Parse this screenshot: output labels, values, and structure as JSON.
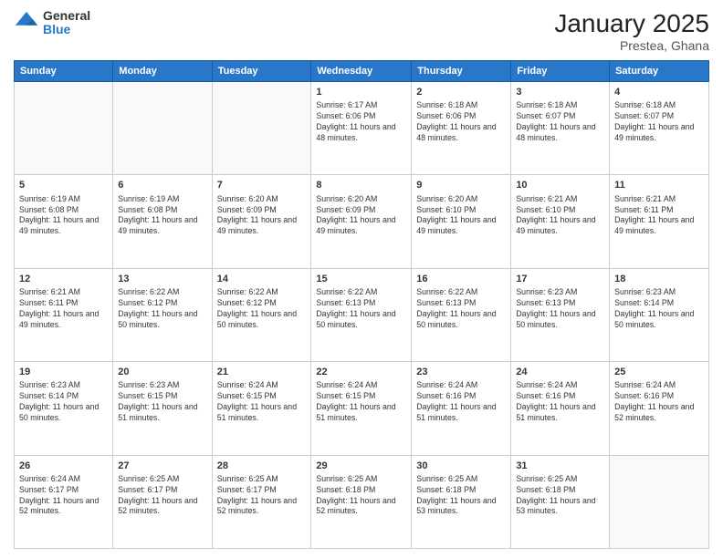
{
  "header": {
    "logo": {
      "general": "General",
      "blue": "Blue"
    },
    "title": "January 2025",
    "subtitle": "Prestea, Ghana"
  },
  "calendar": {
    "days_of_week": [
      "Sunday",
      "Monday",
      "Tuesday",
      "Wednesday",
      "Thursday",
      "Friday",
      "Saturday"
    ],
    "weeks": [
      [
        {
          "day": "",
          "info": ""
        },
        {
          "day": "",
          "info": ""
        },
        {
          "day": "",
          "info": ""
        },
        {
          "day": "1",
          "info": "Sunrise: 6:17 AM\nSunset: 6:06 PM\nDaylight: 11 hours and 48 minutes."
        },
        {
          "day": "2",
          "info": "Sunrise: 6:18 AM\nSunset: 6:06 PM\nDaylight: 11 hours and 48 minutes."
        },
        {
          "day": "3",
          "info": "Sunrise: 6:18 AM\nSunset: 6:07 PM\nDaylight: 11 hours and 48 minutes."
        },
        {
          "day": "4",
          "info": "Sunrise: 6:18 AM\nSunset: 6:07 PM\nDaylight: 11 hours and 49 minutes."
        }
      ],
      [
        {
          "day": "5",
          "info": "Sunrise: 6:19 AM\nSunset: 6:08 PM\nDaylight: 11 hours and 49 minutes."
        },
        {
          "day": "6",
          "info": "Sunrise: 6:19 AM\nSunset: 6:08 PM\nDaylight: 11 hours and 49 minutes."
        },
        {
          "day": "7",
          "info": "Sunrise: 6:20 AM\nSunset: 6:09 PM\nDaylight: 11 hours and 49 minutes."
        },
        {
          "day": "8",
          "info": "Sunrise: 6:20 AM\nSunset: 6:09 PM\nDaylight: 11 hours and 49 minutes."
        },
        {
          "day": "9",
          "info": "Sunrise: 6:20 AM\nSunset: 6:10 PM\nDaylight: 11 hours and 49 minutes."
        },
        {
          "day": "10",
          "info": "Sunrise: 6:21 AM\nSunset: 6:10 PM\nDaylight: 11 hours and 49 minutes."
        },
        {
          "day": "11",
          "info": "Sunrise: 6:21 AM\nSunset: 6:11 PM\nDaylight: 11 hours and 49 minutes."
        }
      ],
      [
        {
          "day": "12",
          "info": "Sunrise: 6:21 AM\nSunset: 6:11 PM\nDaylight: 11 hours and 49 minutes."
        },
        {
          "day": "13",
          "info": "Sunrise: 6:22 AM\nSunset: 6:12 PM\nDaylight: 11 hours and 50 minutes."
        },
        {
          "day": "14",
          "info": "Sunrise: 6:22 AM\nSunset: 6:12 PM\nDaylight: 11 hours and 50 minutes."
        },
        {
          "day": "15",
          "info": "Sunrise: 6:22 AM\nSunset: 6:13 PM\nDaylight: 11 hours and 50 minutes."
        },
        {
          "day": "16",
          "info": "Sunrise: 6:22 AM\nSunset: 6:13 PM\nDaylight: 11 hours and 50 minutes."
        },
        {
          "day": "17",
          "info": "Sunrise: 6:23 AM\nSunset: 6:13 PM\nDaylight: 11 hours and 50 minutes."
        },
        {
          "day": "18",
          "info": "Sunrise: 6:23 AM\nSunset: 6:14 PM\nDaylight: 11 hours and 50 minutes."
        }
      ],
      [
        {
          "day": "19",
          "info": "Sunrise: 6:23 AM\nSunset: 6:14 PM\nDaylight: 11 hours and 50 minutes."
        },
        {
          "day": "20",
          "info": "Sunrise: 6:23 AM\nSunset: 6:15 PM\nDaylight: 11 hours and 51 minutes."
        },
        {
          "day": "21",
          "info": "Sunrise: 6:24 AM\nSunset: 6:15 PM\nDaylight: 11 hours and 51 minutes."
        },
        {
          "day": "22",
          "info": "Sunrise: 6:24 AM\nSunset: 6:15 PM\nDaylight: 11 hours and 51 minutes."
        },
        {
          "day": "23",
          "info": "Sunrise: 6:24 AM\nSunset: 6:16 PM\nDaylight: 11 hours and 51 minutes."
        },
        {
          "day": "24",
          "info": "Sunrise: 6:24 AM\nSunset: 6:16 PM\nDaylight: 11 hours and 51 minutes."
        },
        {
          "day": "25",
          "info": "Sunrise: 6:24 AM\nSunset: 6:16 PM\nDaylight: 11 hours and 52 minutes."
        }
      ],
      [
        {
          "day": "26",
          "info": "Sunrise: 6:24 AM\nSunset: 6:17 PM\nDaylight: 11 hours and 52 minutes."
        },
        {
          "day": "27",
          "info": "Sunrise: 6:25 AM\nSunset: 6:17 PM\nDaylight: 11 hours and 52 minutes."
        },
        {
          "day": "28",
          "info": "Sunrise: 6:25 AM\nSunset: 6:17 PM\nDaylight: 11 hours and 52 minutes."
        },
        {
          "day": "29",
          "info": "Sunrise: 6:25 AM\nSunset: 6:18 PM\nDaylight: 11 hours and 52 minutes."
        },
        {
          "day": "30",
          "info": "Sunrise: 6:25 AM\nSunset: 6:18 PM\nDaylight: 11 hours and 53 minutes."
        },
        {
          "day": "31",
          "info": "Sunrise: 6:25 AM\nSunset: 6:18 PM\nDaylight: 11 hours and 53 minutes."
        },
        {
          "day": "",
          "info": ""
        }
      ]
    ]
  }
}
